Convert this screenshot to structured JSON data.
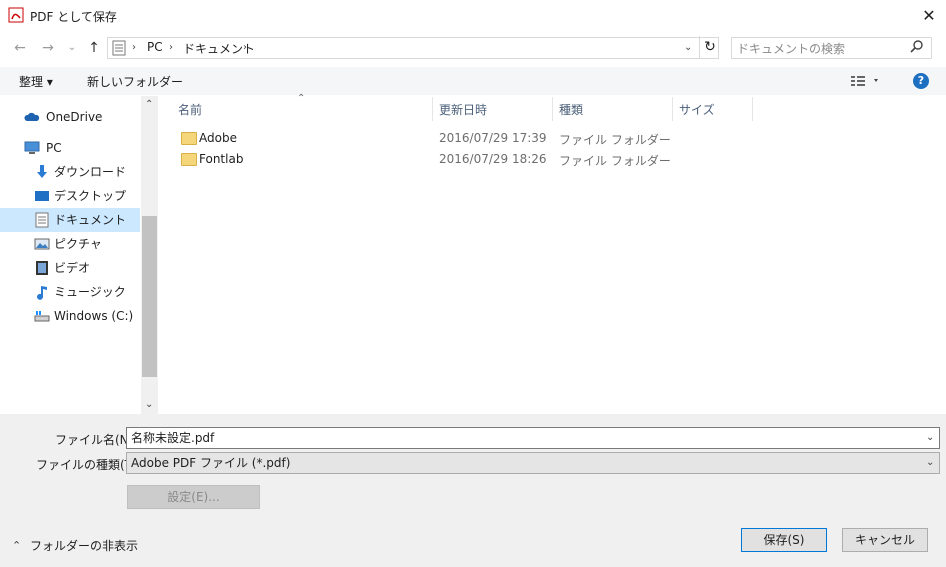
{
  "window": {
    "title": "PDF として保存",
    "close_label": "✕",
    "accent_color": "#0078d7",
    "selected_color": "#cce8ff"
  },
  "nav": {
    "back_icon": "←",
    "forward_icon": "→",
    "recent_icon": "⌄",
    "up_icon": "↑",
    "breadcrumb": [
      "PC",
      "ドキュメント"
    ],
    "refresh_icon": "↻",
    "search_placeholder": "ドキュメントの検索"
  },
  "toolbar": {
    "organize_label": "整理 ▾",
    "new_folder_label": "新しいフォルダー",
    "help_label": "?"
  },
  "sidebar": {
    "items": [
      {
        "label": "OneDrive",
        "icon": "cloud-icon"
      },
      {
        "label": "PC",
        "icon": "computer-icon"
      },
      {
        "label": "ダウンロード",
        "icon": "download-icon"
      },
      {
        "label": "デスクトップ",
        "icon": "desktop-icon"
      },
      {
        "label": "ドキュメント",
        "icon": "document-icon",
        "selected": true
      },
      {
        "label": "ピクチャ",
        "icon": "picture-icon"
      },
      {
        "label": "ビデオ",
        "icon": "video-icon"
      },
      {
        "label": "ミュージック",
        "icon": "music-icon"
      },
      {
        "label": "Windows (C:)",
        "icon": "drive-icon"
      }
    ]
  },
  "list": {
    "columns": [
      "名前",
      "更新日時",
      "種類",
      "サイズ"
    ],
    "rows": [
      {
        "name": "Adobe",
        "date": "2016/07/29 17:39",
        "type": "ファイル フォルダー"
      },
      {
        "name": "Fontlab",
        "date": "2016/07/29 18:26",
        "type": "ファイル フォルダー"
      }
    ]
  },
  "form": {
    "filename_label": "ファイル名(N):",
    "filename_value": "名称未設定.pdf",
    "filetype_label": "ファイルの種類(T):",
    "filetype_value": "Adobe PDF ファイル (*.pdf)",
    "settings_label": "設定(E)..."
  },
  "footer": {
    "hide_folders_label": "フォルダーの非表示",
    "save_label": "保存(S)",
    "cancel_label": "キャンセル"
  }
}
